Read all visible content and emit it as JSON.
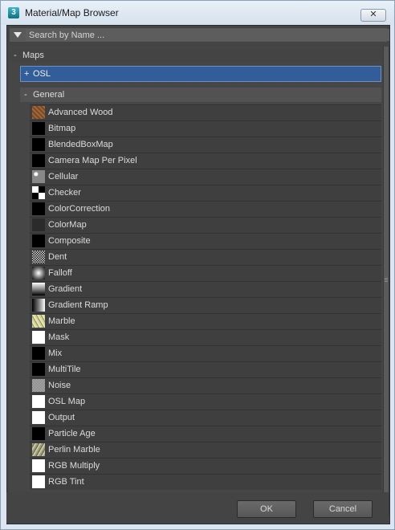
{
  "window": {
    "title": "Material/Map Browser",
    "close_label": "✕"
  },
  "search": {
    "placeholder": "Search by Name ..."
  },
  "tree": {
    "maps": {
      "sign": "-",
      "label": "Maps"
    },
    "osl": {
      "sign": "+",
      "label": "OSL"
    },
    "general": {
      "sign": "-",
      "label": "General"
    },
    "items": [
      {
        "label": "Advanced Wood",
        "thumb": "wood"
      },
      {
        "label": "Bitmap",
        "thumb": "black"
      },
      {
        "label": "BlendedBoxMap",
        "thumb": "black"
      },
      {
        "label": "Camera Map Per Pixel",
        "thumb": "black"
      },
      {
        "label": "Cellular",
        "thumb": "cellular"
      },
      {
        "label": "Checker",
        "thumb": "checker"
      },
      {
        "label": "ColorCorrection",
        "thumb": "black"
      },
      {
        "label": "ColorMap",
        "thumb": "dark"
      },
      {
        "label": "Composite",
        "thumb": "black"
      },
      {
        "label": "Dent",
        "thumb": "dent"
      },
      {
        "label": "Falloff",
        "thumb": "falloff"
      },
      {
        "label": "Gradient",
        "thumb": "gradient"
      },
      {
        "label": "Gradient Ramp",
        "thumb": "ramp"
      },
      {
        "label": "Marble",
        "thumb": "marble"
      },
      {
        "label": "Mask",
        "thumb": "white"
      },
      {
        "label": "Mix",
        "thumb": "black"
      },
      {
        "label": "MultiTile",
        "thumb": "black"
      },
      {
        "label": "Noise",
        "thumb": "noise"
      },
      {
        "label": "OSL Map",
        "thumb": "white"
      },
      {
        "label": "Output",
        "thumb": "white"
      },
      {
        "label": "Particle Age",
        "thumb": "black"
      },
      {
        "label": "Perlin Marble",
        "thumb": "perlin"
      },
      {
        "label": "RGB Multiply",
        "thumb": "white"
      },
      {
        "label": "RGB Tint",
        "thumb": "white"
      }
    ]
  },
  "buttons": {
    "ok": "OK",
    "cancel": "Cancel"
  },
  "colors": {
    "selected_row": "#315e99",
    "panel_bg": "#444444"
  }
}
